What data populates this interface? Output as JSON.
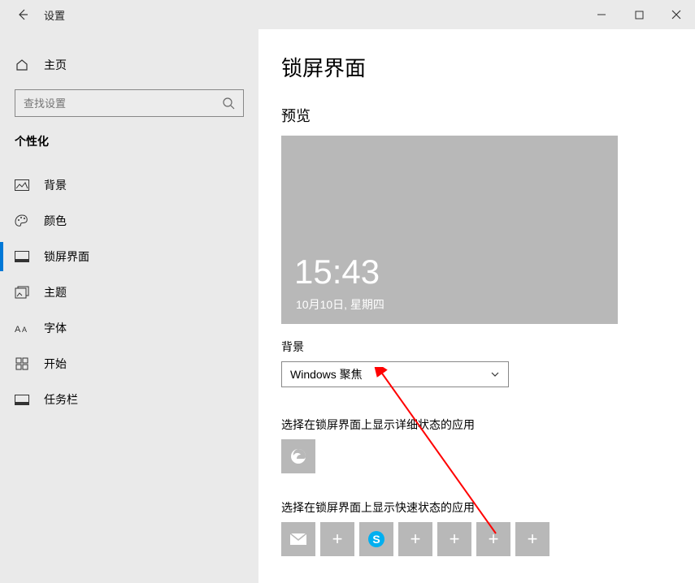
{
  "window": {
    "title": "设置"
  },
  "sidebar": {
    "home": "主页",
    "search_placeholder": "查找设置",
    "category": "个性化",
    "items": [
      {
        "label": "背景"
      },
      {
        "label": "颜色"
      },
      {
        "label": "锁屏界面"
      },
      {
        "label": "主题"
      },
      {
        "label": "字体"
      },
      {
        "label": "开始"
      },
      {
        "label": "任务栏"
      }
    ]
  },
  "page": {
    "title": "锁屏界面",
    "preview_label": "预览",
    "preview_time": "15:43",
    "preview_date": "10月10日, 星期四",
    "background_label": "背景",
    "background_dropdown": "Windows 聚焦",
    "detailed_label": "选择在锁屏界面上显示详细状态的应用",
    "quick_label": "选择在锁屏界面上显示快速状态的应用"
  }
}
